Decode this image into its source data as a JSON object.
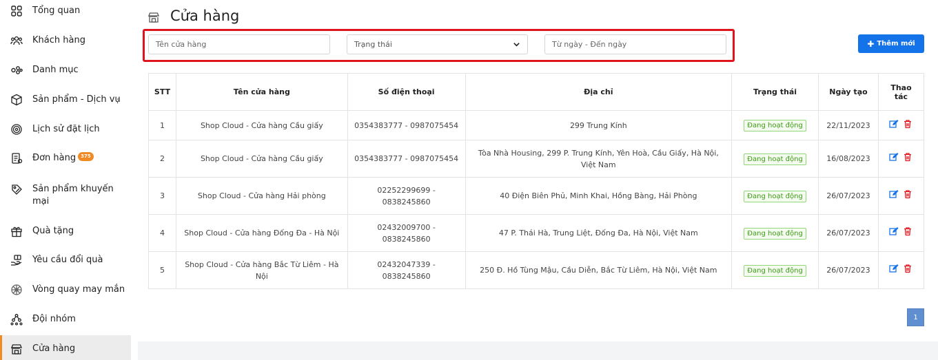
{
  "sidebar": {
    "items": [
      {
        "label": "Tổng quan",
        "icon": "grid-icon"
      },
      {
        "label": "Khách hàng",
        "icon": "users-icon"
      },
      {
        "label": "Danh mục",
        "icon": "category-icon"
      },
      {
        "label": "Sản phẩm - Dịch vụ",
        "icon": "box-icon",
        "chevron": "‹"
      },
      {
        "label": "Lịch sử đặt lịch",
        "icon": "history-icon"
      },
      {
        "label": "Đơn hàng",
        "icon": "order-icon",
        "badge": "375"
      },
      {
        "label": "Sản phẩm khuyến mại",
        "icon": "promo-icon"
      },
      {
        "label": "Quà tặng",
        "icon": "gift-icon"
      },
      {
        "label": "Yêu cầu đổi quà",
        "icon": "exchange-gift-icon"
      },
      {
        "label": "Vòng quay may mắn",
        "icon": "wheel-icon"
      },
      {
        "label": "Đội nhóm",
        "icon": "team-icon"
      },
      {
        "label": "Cửa hàng",
        "icon": "store-icon",
        "active": true
      }
    ]
  },
  "header": {
    "title": "Cửa hàng",
    "icon": "store-icon"
  },
  "filters": {
    "name_placeholder": "Tên cửa hàng",
    "status_value": "Trạng thái",
    "date_placeholder": "Từ ngày - Đến ngày"
  },
  "toolbar": {
    "add_label": "Thêm mới"
  },
  "table": {
    "headers": [
      "STT",
      "Tên cửa hàng",
      "Số điện thoại",
      "Địa chỉ",
      "Trạng thái",
      "Ngày tạo",
      "Thao tác"
    ],
    "rows": [
      {
        "stt": "1",
        "name": "Shop Cloud - Cửa hàng Cầu giấy",
        "phone": "0354383777 - 0987075454",
        "address": "299 Trung Kính",
        "status": "Đang hoạt động",
        "date": "22/11/2023"
      },
      {
        "stt": "2",
        "name": "Shop Cloud - Cửa hàng Cầu giấy",
        "phone": "0354383777 - 0987075454",
        "address": "Tòa Nhà Housing, 299 P. Trung Kính, Yên Hoà, Cầu Giấy, Hà Nội, Việt Nam",
        "status": "Đang hoạt động",
        "date": "16/08/2023"
      },
      {
        "stt": "3",
        "name": "Shop Cloud - Cửa hàng Hải phòng",
        "phone": "02252299699 - 0838245860",
        "address": "40 Điện Biên Phủ, Minh Khai, Hồng Bàng, Hải Phòng",
        "status": "Đang hoạt động",
        "date": "26/07/2023"
      },
      {
        "stt": "4",
        "name": "Shop Cloud - Cửa hàng Đống Đa - Hà Nội",
        "phone": "02432009700 - 0838245860",
        "address": "47 P. Thái Hà, Trung Liệt, Đống Đa, Hà Nội, Việt Nam",
        "status": "Đang hoạt động",
        "date": "26/07/2023"
      },
      {
        "stt": "5",
        "name": "Shop Cloud - Cửa hàng Bắc Từ Liêm - Hà Nội",
        "phone": "02432047339 - 0838245860",
        "address": "250 Đ. Hồ Tùng Mậu, Cầu Diễn, Bắc Từ Liêm, Hà Nội, Việt Nam",
        "status": "Đang hoạt động",
        "date": "26/07/2023"
      }
    ]
  },
  "pagination": {
    "current": "1"
  },
  "colors": {
    "accent": "#1573ea",
    "active_border": "#f08a24",
    "highlight": "#e0141d",
    "status_green": "#3e9a16",
    "delete_red": "#e0141d"
  }
}
